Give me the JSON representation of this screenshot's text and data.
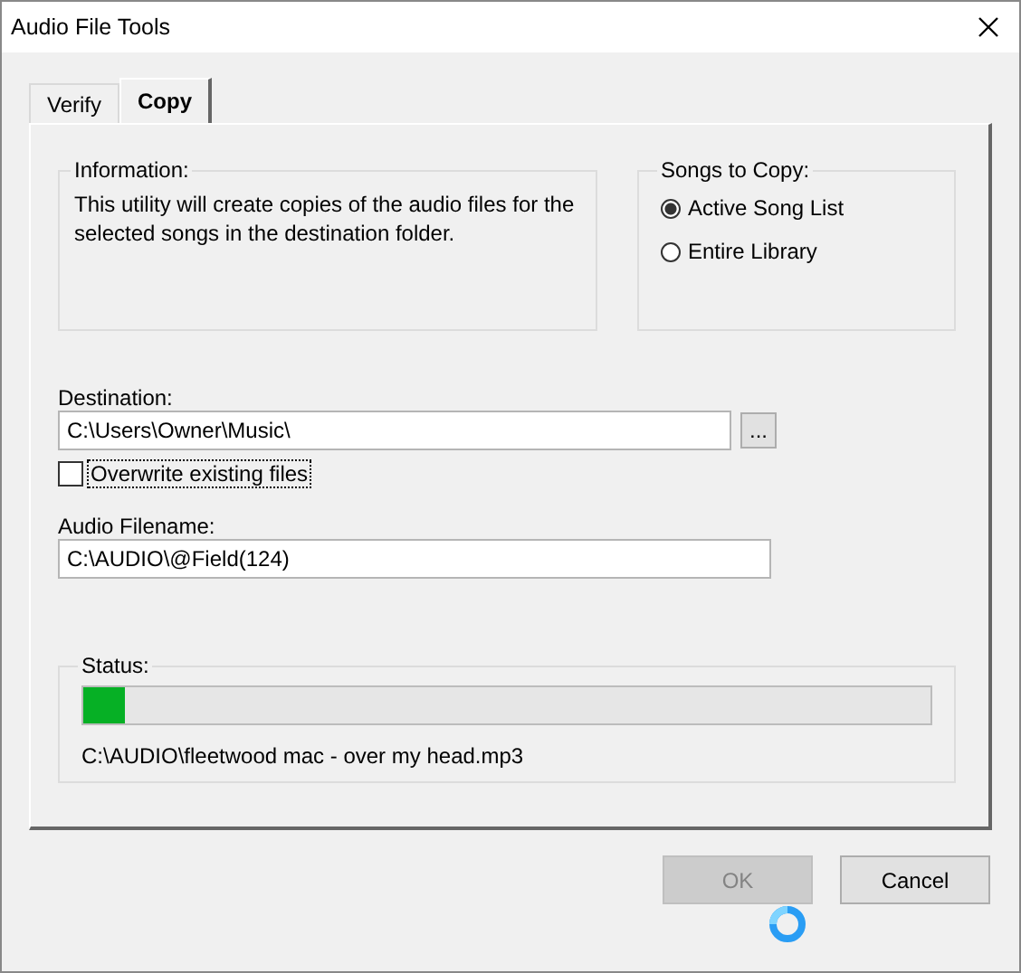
{
  "window": {
    "title": "Audio File Tools"
  },
  "tabs": [
    {
      "label": "Verify",
      "selected": false
    },
    {
      "label": "Copy",
      "selected": true
    }
  ],
  "information": {
    "title": "Information:",
    "text": "This utility will create copies of the audio files for the selected songs in the destination folder."
  },
  "songs_to_copy": {
    "title": "Songs to Copy:",
    "options": [
      {
        "label": "Active Song List",
        "selected": true
      },
      {
        "label": "Entire Library",
        "selected": false
      }
    ]
  },
  "destination": {
    "label": "Destination:",
    "value": "C:\\Users\\Owner\\Music\\",
    "browse": "..."
  },
  "overwrite": {
    "label": "Overwrite existing files",
    "checked": false
  },
  "audio_filename": {
    "label": "Audio Filename:",
    "value": "C:\\AUDIO\\@Field(124)"
  },
  "status": {
    "title": "Status:",
    "level": 0.05,
    "text": "C:\\AUDIO\\fleetwood mac - over my head.mp3"
  },
  "buttons": [
    {
      "label": "OK",
      "disabled": true
    },
    {
      "label": "Cancel",
      "disabled": false
    }
  ]
}
